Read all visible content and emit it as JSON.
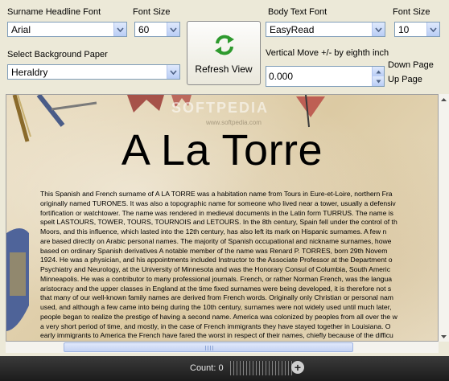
{
  "controls": {
    "headline_font": {
      "label": "Surname Headline Font",
      "value": "Arial"
    },
    "headline_size": {
      "label": "Font Size",
      "value": "60"
    },
    "background_paper": {
      "label": "Select Background Paper",
      "value": "Heraldry"
    },
    "body_font": {
      "label": "Body Text Font",
      "value": "EasyRead"
    },
    "body_size": {
      "label": "Font Size",
      "value": "10"
    },
    "vertical_move": {
      "label": "Vertical Move +/-  by eighth inch",
      "value": "0.000"
    },
    "page_down_label": "Down Page",
    "page_up_label": "Up Page",
    "refresh_label": "Refresh View"
  },
  "document": {
    "headline": "A La Torre",
    "body_lines": [
      "This Spanish and French surname of A LA TORRE was a habitation name from Tours in Eure-et-Loire, northern Fra",
      "originally named TURONES. It was also a topographic name for someone who lived near a tower, usually a defensiv",
      "fortification or watchtower. The name was rendered in medieval documents in the Latin form TURRUS. The name is",
      "spelt LASTOURS, TOWER, TOURS, TOURNOIS and LETOURS. In the 8th century, Spain fell under the control of th",
      "Moors, and this influence, which lasted into the 12th century, has also left its mark on Hispanic surnames. A few n",
      "are based directly on Arabic personal names. The majority of Spanish occupational and nickname surnames, howe",
      "based on ordinary Spanish derivatives A notable member of the name was Renard P. TORRES, born 29th Novem",
      "1924. He was a physician, and his appointments included Instructor to the Associate Professor at the Department o",
      "Psychiatry and Neurology, at the University of Minnesota and was the Honorary Consul of Columbia, South Americ",
      "Minneapolis. He was a contributor to many professional journals. French, or rather Norman French, was the langua",
      "aristocracy and the upper classes in England at the time fixed surnames were being developed, it is therefore not s",
      "that many of our well-known family names are derived from French words. Originally only Christian or personal nam",
      "used, and although a few came into being during the 10th century, surnames were not widely used until much later,",
      "people began to realize the prestige of having a second name. America was colonized by peoples from all over the w",
      "a very short period of time, and mostly, in the case of French immigrants they have stayed together in Louisiana. O",
      "early immigrants to America the French have fared the worst in respect of their names, chiefly because of the difficu"
    ],
    "watermark": "SOFTPEDIA",
    "watermark_url": "www.softpedia.com"
  },
  "status": {
    "count_label": "Count: 0"
  },
  "icons": {
    "refresh": "refresh-arrows-icon",
    "dropdown": "chevron-down-icon",
    "spin_up": "spin-up-icon",
    "spin_down": "spin-down-icon",
    "plus": "plus-icon"
  },
  "colors": {
    "accent_green": "#2e9a2e",
    "paper": "#e2d3b2",
    "statusbar": "#262626"
  }
}
